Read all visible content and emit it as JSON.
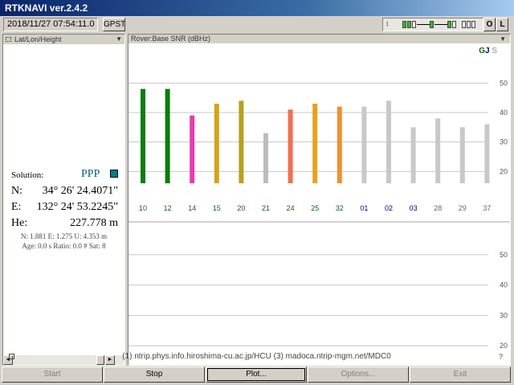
{
  "window": {
    "title": "RTKNAVI ver.2.4.2"
  },
  "toolbar": {
    "time": "2018/11/27 07:54:11.0",
    "time_system": "GPST",
    "info_label": "I",
    "log_label": "O",
    "link_label": "L"
  },
  "left_panel": {
    "header": "Lat/Lon/Height",
    "solution_label": "Solution:",
    "solution_value": "PPP",
    "solution_color": "#008080",
    "lat_label": "N:",
    "lat_value": "34° 26' 24.4071\"",
    "lon_label": "E:",
    "lon_value": "132° 24' 53.2245\"",
    "hgt_label": "He:",
    "hgt_value": "227.778 m",
    "stdev_line": "N: 1.881 E: 1.275 U: 4.353 m",
    "age_line": "Age: 0.0 s Ratio: 0.0 # Sat: 8"
  },
  "right_panel": {
    "header": "Rover:Base SNR (dBHz)",
    "legend_g": "G",
    "legend_j": "J",
    "legend_s": "S"
  },
  "chart_data": [
    {
      "type": "bar",
      "ylim": [
        10,
        55
      ],
      "yticks": [
        20,
        30,
        40,
        50
      ],
      "grid": true,
      "categories": [
        "10",
        "12",
        "14",
        "15",
        "20",
        "21",
        "24",
        "25",
        "32",
        "01",
        "02",
        "03",
        "28",
        "29",
        "37"
      ],
      "values": [
        48,
        48,
        39,
        43,
        44,
        33,
        41,
        43,
        42,
        42,
        44,
        35,
        38,
        35,
        36
      ],
      "bar_colors": [
        "#0a7d0a",
        "#0a7d0a",
        "#e83ab4",
        "#d4a418",
        "#b8a020",
        "#bcbcbc",
        "#f07050",
        "#e8a020",
        "#f09030",
        "#c8c8c8",
        "#c8c8c8",
        "#c8c8c8",
        "#c8c8c8",
        "#c8c8c8",
        "#c8c8c8"
      ],
      "label_colors": [
        "#0a6a0a",
        "#0a6a0a",
        "#0a6a0a",
        "#0a6a0a",
        "#0a6a0a",
        "#0a6a0a",
        "#0a6a0a",
        "#0a6a0a",
        "#0a6a0a",
        "#000080",
        "#000080",
        "#000080",
        "#666666",
        "#666666",
        "#666666"
      ]
    },
    {
      "type": "bar",
      "ylim": [
        10,
        55
      ],
      "yticks": [
        20,
        30,
        40,
        50
      ],
      "grid": true,
      "categories": [],
      "values": []
    }
  ],
  "statusbar": {
    "text": "(1) ntrip.phys.info.hiroshima-cu.ac.jp/HCU (3) madoca.ntrip-mgm.net/MDC0",
    "help_label": "?"
  },
  "buttons": {
    "start": "Start",
    "stop": "Stop",
    "plot": "Plot...",
    "options": "Options...",
    "exit": "Exit"
  }
}
